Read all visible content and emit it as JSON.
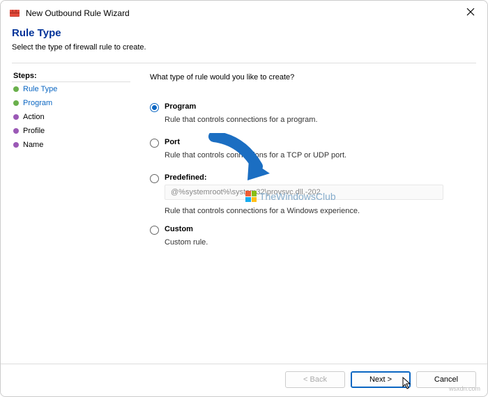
{
  "window": {
    "title": "New Outbound Rule Wizard"
  },
  "header": {
    "title": "Rule Type",
    "subtitle": "Select the type of firewall rule to create."
  },
  "sidebar": {
    "title": "Steps:",
    "items": [
      {
        "label": "Rule Type"
      },
      {
        "label": "Program"
      },
      {
        "label": "Action"
      },
      {
        "label": "Profile"
      },
      {
        "label": "Name"
      }
    ]
  },
  "content": {
    "question": "What type of rule would you like to create?",
    "options": {
      "program": {
        "label": "Program",
        "desc": "Rule that controls connections for a program."
      },
      "port": {
        "label": "Port",
        "desc": "Rule that controls connections for a TCP or UDP port."
      },
      "predefined": {
        "label": "Predefined:",
        "value": "@%systemroot%\\system32\\provsvc.dll,-202",
        "desc": "Rule that controls connections for a Windows experience."
      },
      "custom": {
        "label": "Custom",
        "desc": "Custom rule."
      }
    }
  },
  "footer": {
    "back": "< Back",
    "next": "Next >",
    "cancel": "Cancel"
  },
  "watermark": {
    "text": "TheWindowsClub"
  },
  "attribution": "wsxdn.com"
}
